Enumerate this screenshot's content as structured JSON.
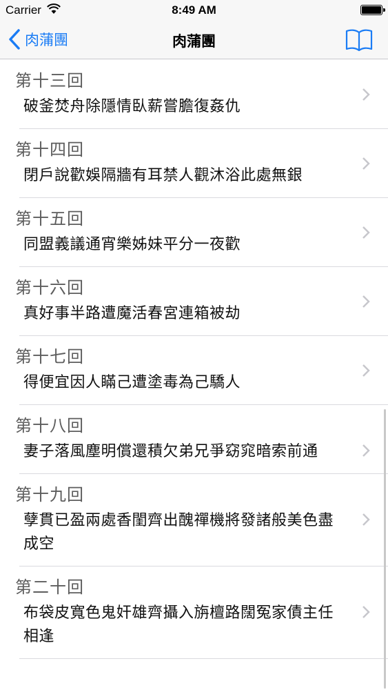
{
  "status": {
    "carrier": "Carrier",
    "time": "8:49 AM"
  },
  "nav": {
    "back_label": "肉蒲團",
    "title": "肉蒲團",
    "accent_color": "#1a7cf5",
    "back_icon": "chevron-left-icon",
    "right_icon": "book-icon"
  },
  "chapters": [
    {
      "number": "第十三回",
      "title": "破釜焚舟除隱情臥薪嘗膽復姦仇"
    },
    {
      "number": "第十四回",
      "title": "閉戶說歡娛隔牆有耳禁人觀沐浴此處無銀"
    },
    {
      "number": "第十五回",
      "title": "同盟義議通宵樂姊妹平分一夜歡"
    },
    {
      "number": "第十六回",
      "title": "真好事半路遭魔活春宮連箱被劫"
    },
    {
      "number": "第十七回",
      "title": "得便宜因人瞞己遭塗毒為己驕人"
    },
    {
      "number": "第十八回",
      "title": "妻子落風塵明償還積欠弟兄爭窈窕暗索前通"
    },
    {
      "number": "第十九回",
      "title": "孽貫已盈兩處香閨齊出醜禪機將發諸般美色盡成空"
    },
    {
      "number": "第二十回",
      "title": "布袋皮寬色鬼奸雄齊攝入旃檀路闊冤家債主任相逢"
    }
  ]
}
